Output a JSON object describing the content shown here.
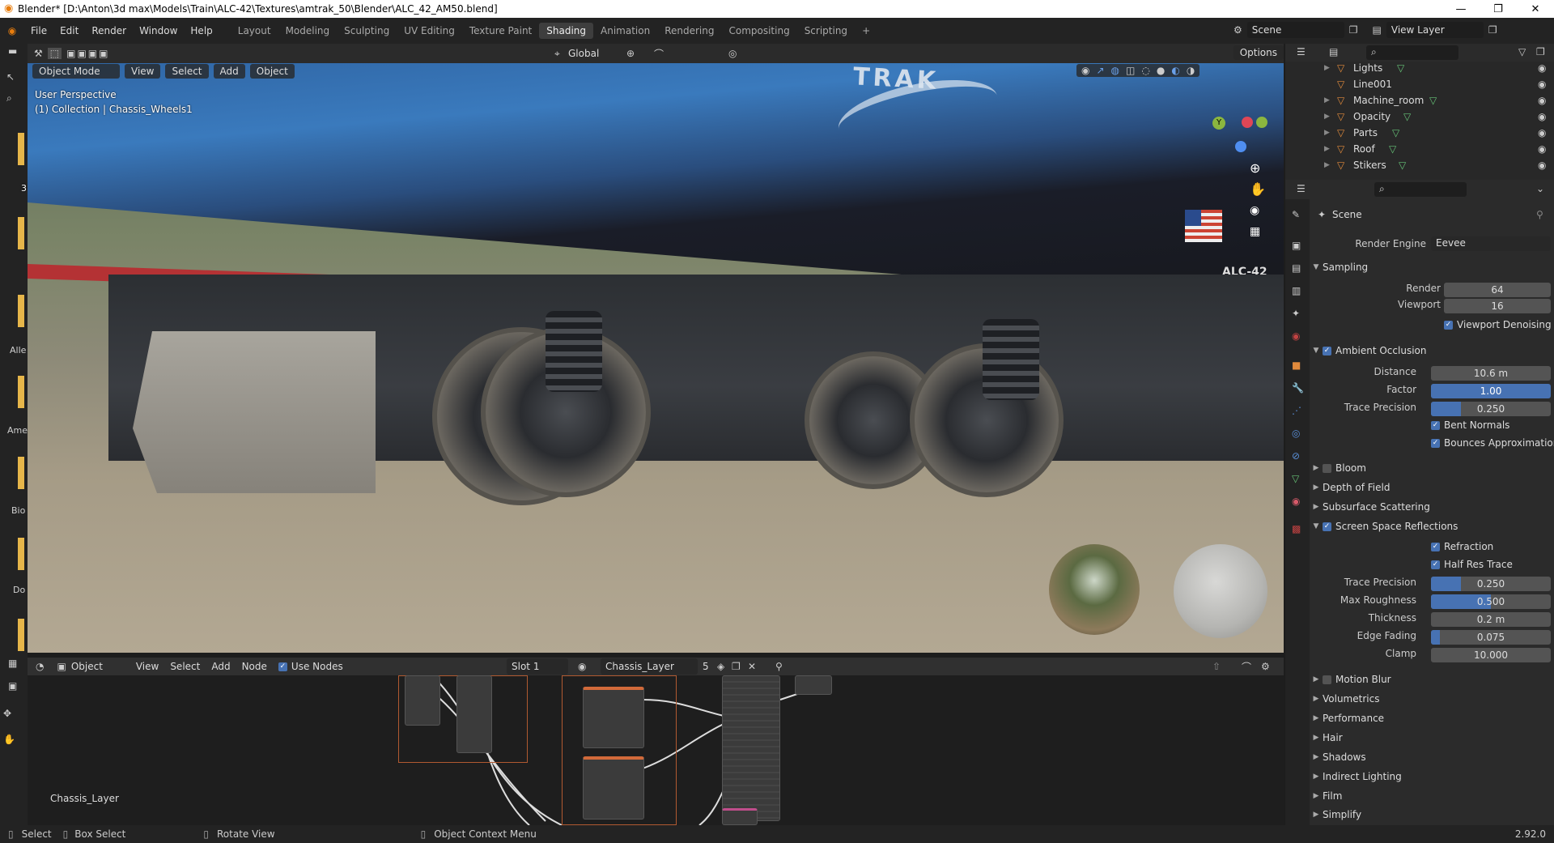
{
  "window": {
    "title": "Blender* [D:\\Anton\\3d max\\Models\\Train\\ALC-42\\Textures\\amtrak_50\\Blender\\ALC_42_AM50.blend]",
    "min_icon": "minimize-icon",
    "max_icon": "maximize-icon",
    "close_icon": "close-icon"
  },
  "menu": [
    "File",
    "Edit",
    "Render",
    "Window",
    "Help"
  ],
  "workspaces": [
    "Layout",
    "Modeling",
    "Sculpting",
    "UV Editing",
    "Texture Paint",
    "Shading",
    "Animation",
    "Rendering",
    "Compositing",
    "Scripting"
  ],
  "active_workspace": "Shading",
  "scene": {
    "label": "Scene",
    "view_layer": "View Layer"
  },
  "viewport_header": {
    "mode": "Object Mode",
    "menus": [
      "View",
      "Select",
      "Add",
      "Object"
    ],
    "orientation": "Global",
    "options": "Options"
  },
  "viewport": {
    "perspective": "User Perspective",
    "collection": "(1) Collection | Chassis_Wheels1",
    "decal_text": "ALC-42",
    "logo_text": "TRAK",
    "axes": [
      "Y",
      "X",
      "Z"
    ]
  },
  "node_header": {
    "type": "Object",
    "menus": [
      "View",
      "Select",
      "Add",
      "Node"
    ],
    "use_nodes": "Use Nodes",
    "slot": "Slot 1",
    "material": "Chassis_Layer",
    "users": "5"
  },
  "node_editor": {
    "label": "Chassis_Layer"
  },
  "outliner": {
    "items": [
      {
        "name": "Lights"
      },
      {
        "name": "Line001"
      },
      {
        "name": "Machine_room"
      },
      {
        "name": "Opacity"
      },
      {
        "name": "Parts"
      },
      {
        "name": "Roof"
      },
      {
        "name": "Stikers"
      }
    ]
  },
  "properties": {
    "context": "Scene",
    "render_engine_label": "Render Engine",
    "render_engine": "Eevee",
    "sampling": {
      "title": "Sampling",
      "render_label": "Render",
      "render": "64",
      "viewport_label": "Viewport",
      "viewport": "16",
      "denoise": "Viewport Denoising"
    },
    "ao": {
      "title": "Ambient Occlusion",
      "distance_label": "Distance",
      "distance": "10.6 m",
      "factor_label": "Factor",
      "factor": "1.00",
      "trace_label": "Trace Precision",
      "trace": "0.250",
      "trace_fraction": 0.25,
      "bent": "Bent Normals",
      "bounces": "Bounces Approximation"
    },
    "bloom": "Bloom",
    "dof": "Depth of Field",
    "sss": "Subsurface Scattering",
    "ssr": {
      "title": "Screen Space Reflections",
      "refraction": "Refraction",
      "half_res": "Half Res Trace",
      "trace_label": "Trace Precision",
      "trace": "0.250",
      "trace_fraction": 0.25,
      "rough_label": "Max Roughness",
      "rough": "0.500",
      "rough_fraction": 0.5,
      "thick_label": "Thickness",
      "thick": "0.2 m",
      "fade_label": "Edge Fading",
      "fade": "0.075",
      "fade_fraction": 0.075,
      "clamp_label": "Clamp",
      "clamp": "10.000"
    },
    "collapsed": [
      "Motion Blur",
      "Volumetrics",
      "Performance",
      "Hair",
      "Shadows",
      "Indirect Lighting",
      "Film",
      "Simplify"
    ]
  },
  "left_labels": [
    "3",
    "Alle",
    "Ame",
    "Bio",
    "Do"
  ],
  "statusbar": {
    "select": "Select",
    "box_select": "Box Select",
    "rotate": "Rotate View",
    "context": "Object Context Menu",
    "version": "2.92.0"
  },
  "colors": {
    "accent": "#4772b3",
    "active_ws": "#3e3e3e",
    "stripe": "#b43234"
  }
}
